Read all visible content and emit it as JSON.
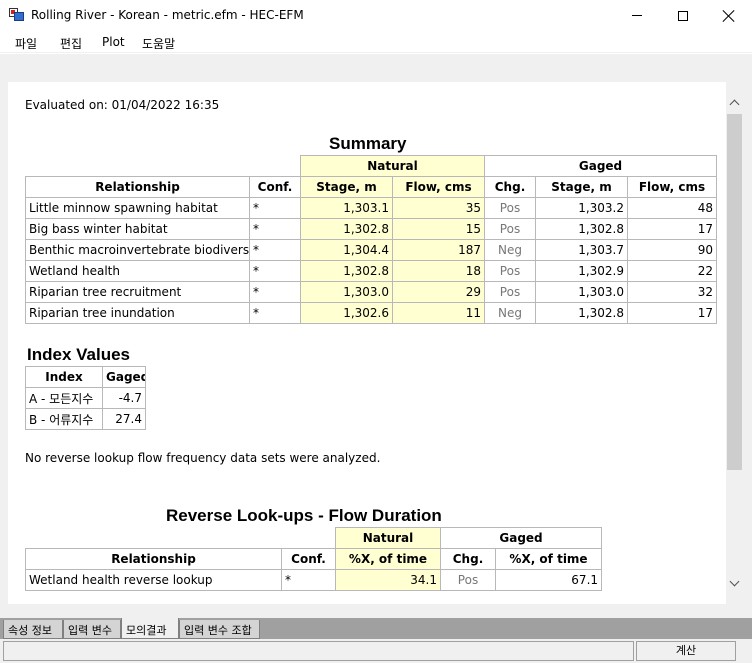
{
  "window": {
    "title": "Rolling River - Korean - metric.efm - HEC-EFM"
  },
  "menu": [
    "파일",
    "편집",
    "Plot",
    "도움말"
  ],
  "evaluated": "Evaluated on: 01/04/2022 16:35",
  "summary": {
    "title": "Summary",
    "group_natural": "Natural",
    "group_gaged": "Gaged",
    "headers": [
      "Relationship",
      "Conf.",
      "Stage, m",
      "Flow, cms",
      "Chg.",
      "Stage, m",
      "Flow, cms"
    ],
    "rows": [
      [
        "Little minnow spawning habitat",
        "*",
        "1,303.1",
        "35",
        "Pos",
        "1,303.2",
        "48"
      ],
      [
        "Big bass winter habitat",
        "*",
        "1,302.8",
        "15",
        "Pos",
        "1,302.8",
        "17"
      ],
      [
        "Benthic macroinvertebrate biodiversity",
        "*",
        "1,304.4",
        "187",
        "Neg",
        "1,303.7",
        "90"
      ],
      [
        "Wetland health",
        "*",
        "1,302.8",
        "18",
        "Pos",
        "1,302.9",
        "22"
      ],
      [
        "Riparian tree recruitment",
        "*",
        "1,303.0",
        "29",
        "Pos",
        "1,303.0",
        "32"
      ],
      [
        "Riparian tree inundation",
        "*",
        "1,302.6",
        "11",
        "Neg",
        "1,302.8",
        "17"
      ]
    ]
  },
  "index": {
    "title": "Index Values",
    "headers": [
      "Index",
      "Gaged"
    ],
    "rows": [
      [
        "A - 모든지수",
        "-4.7"
      ],
      [
        "B - 어류지수",
        "27.4"
      ]
    ]
  },
  "note": "No reverse lookup flow frequency data sets were analyzed.",
  "reverse": {
    "title": "Reverse Look-ups - Flow Duration",
    "group_natural": "Natural",
    "group_gaged": "Gaged",
    "headers": [
      "Relationship",
      "Conf.",
      "%X, of time",
      "Chg.",
      "%X, of time"
    ],
    "rows": [
      [
        "Wetland health reverse lookup",
        "*",
        "34.1",
        "Pos",
        "67.1"
      ]
    ]
  },
  "tabs": [
    "속성 정보",
    "입력 변수",
    "모의결과",
    "입력 변수 조합"
  ],
  "active_tab": "모의결과",
  "status_button": "계산"
}
